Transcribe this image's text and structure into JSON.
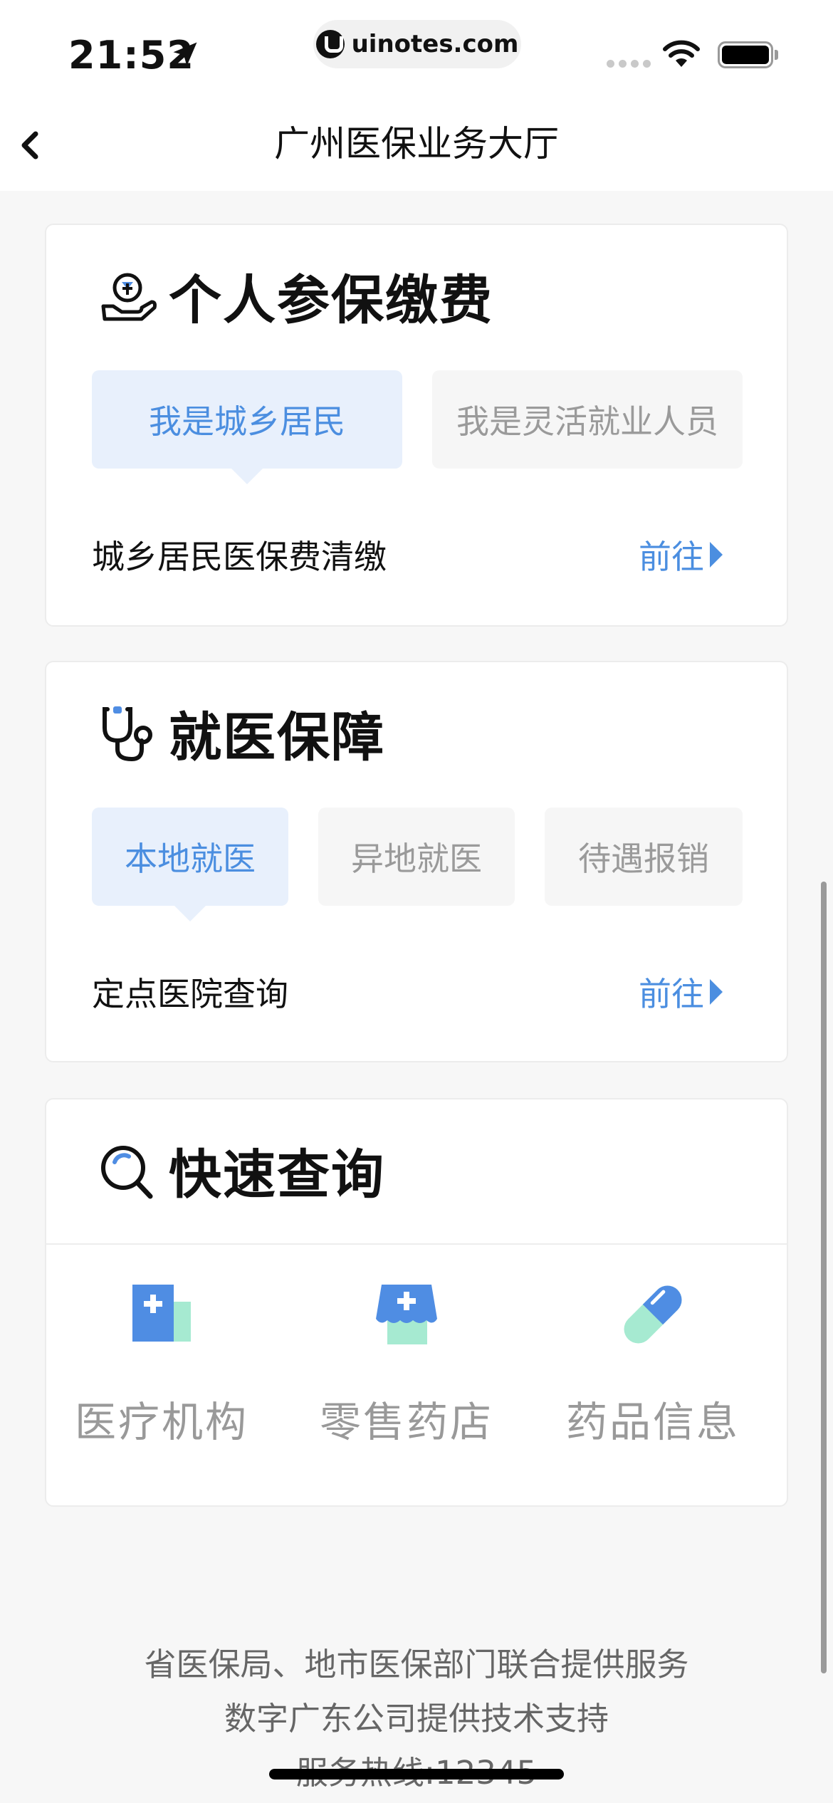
{
  "status_bar": {
    "time": "21:52",
    "url": "uinotes.com"
  },
  "nav": {
    "title": "广州医保业务大厅"
  },
  "payment_card": {
    "title": "个人参保缴费",
    "tabs": [
      {
        "label": "我是城乡居民",
        "active": true
      },
      {
        "label": "我是灵活就业人员",
        "active": false
      }
    ],
    "row_label": "城乡居民医保费清缴",
    "link_label": "前往"
  },
  "medical_card": {
    "title": "就医保障",
    "tabs": [
      {
        "label": "本地就医",
        "active": true
      },
      {
        "label": "异地就医",
        "active": false
      },
      {
        "label": "待遇报销",
        "active": false
      }
    ],
    "row_label": "定点医院查询",
    "link_label": "前往"
  },
  "quick_card": {
    "title": "快速查询",
    "items": [
      {
        "label": "医疗机构",
        "icon": "hospital-icon"
      },
      {
        "label": "零售药店",
        "icon": "pharmacy-icon"
      },
      {
        "label": "药品信息",
        "icon": "pill-icon"
      }
    ]
  },
  "footer": {
    "line1": "省医保局、地市医保部门联合提供服务",
    "line2": "数字广东公司提供技术支持",
    "line3": "服务热线:12345"
  },
  "colors": {
    "accent": "#4b8ee0",
    "tab_active_bg": "#e8f0fc",
    "tab_inactive_bg": "#f6f6f6",
    "icon_blue": "#4f8de3",
    "icon_green": "#a6ead1"
  }
}
